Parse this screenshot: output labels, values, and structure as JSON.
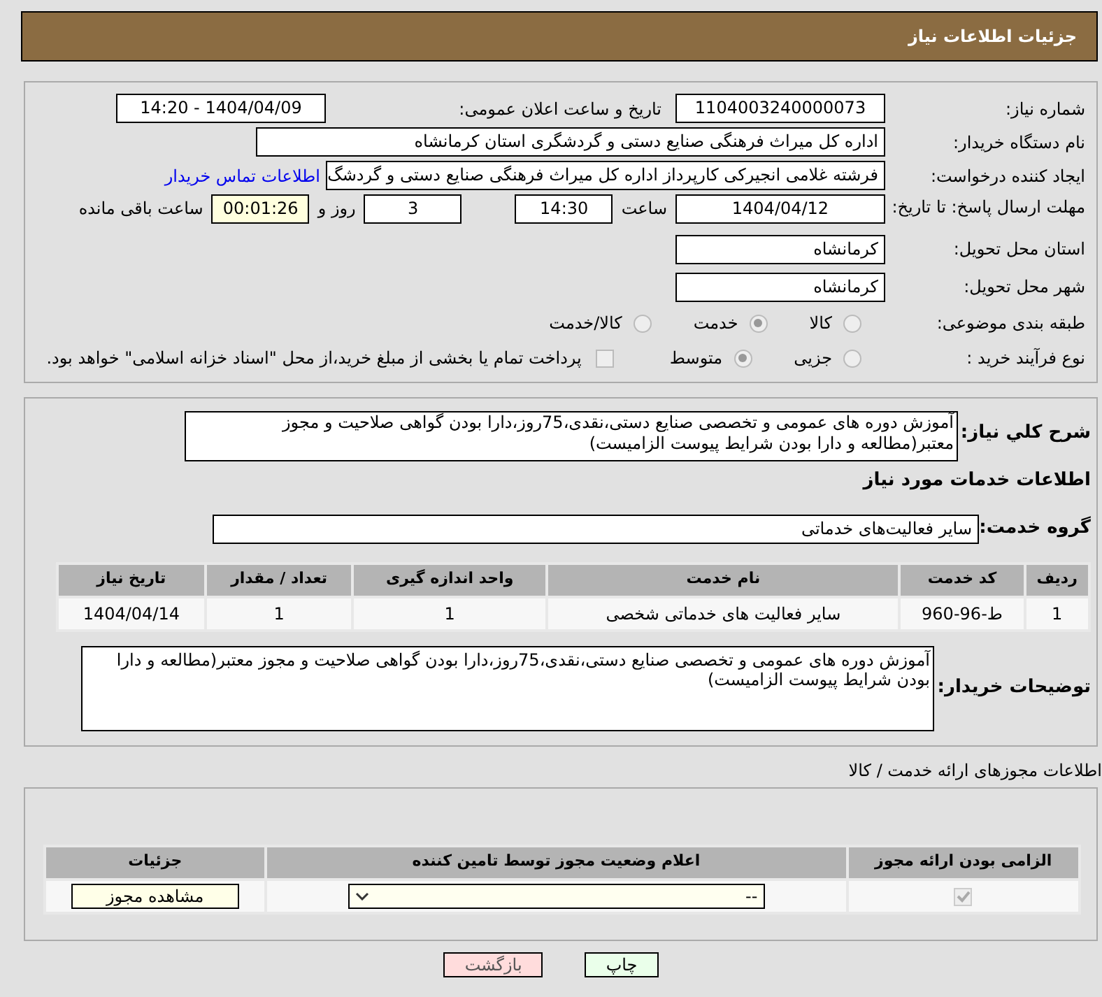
{
  "header": {
    "title": "جزئیات اطلاعات نیاز"
  },
  "details": {
    "need_number": {
      "label": "شماره نیاز:",
      "value": "1104003240000073"
    },
    "announce": {
      "label": "تاریخ و ساعت اعلان عمومی:",
      "value": "1404/04/09 - 14:20"
    },
    "buyer_org": {
      "label": "نام دستگاه خریدار:",
      "value": "اداره کل میراث فرهنگی  صنایع دستی و گردشگری استان کرمانشاه"
    },
    "creator": {
      "label": "ایجاد کننده درخواست:",
      "value": "فرشته غلامی انجیرکی کارپرداز اداره کل میراث فرهنگی  صنایع دستی و گردشگ",
      "link": "اطلاعات تماس خریدار"
    },
    "deadline": {
      "label": "مهلت ارسال پاسخ: تا تاریخ:",
      "date": "1404/04/12",
      "time_label": "ساعت",
      "time": "14:30",
      "days": "3",
      "days_label": "روز و",
      "remaining": "00:01:26",
      "remaining_label": "ساعت باقی مانده"
    },
    "province": {
      "label": "استان محل تحویل:",
      "value": "کرمانشاه"
    },
    "city": {
      "label": "شهر محل تحویل:",
      "value": "کرمانشاه"
    },
    "category": {
      "label": "طبقه بندی موضوعی:",
      "options": [
        {
          "label": "کالا",
          "selected": false
        },
        {
          "label": "خدمت",
          "selected": true
        },
        {
          "label": "کالا/خدمت",
          "selected": false
        }
      ]
    },
    "process": {
      "label": "نوع فرآیند خرید :",
      "options": [
        {
          "label": "جزیی",
          "selected": false
        },
        {
          "label": "متوسط",
          "selected": true
        }
      ],
      "payment": {
        "checked": false,
        "text": "پرداخت تمام یا بخشی از مبلغ خرید،از محل \"اسناد خزانه اسلامی\" خواهد بود."
      }
    }
  },
  "need": {
    "description_label": "شرح کلي نياز:",
    "description": "آموزش دوره های عمومی و تخصصی صنایع دستی،نقدی،75روز،دارا بودن گواهی صلاحیت و مجوز معتبر(مطالعه و دارا بودن شرایط پیوست الزامیست)",
    "services_heading": "اطلاعات خدمات مورد نیاز",
    "service_group": {
      "label": "گروه خدمت:",
      "value": "سایر فعالیت‌های خدماتی"
    },
    "table": {
      "columns": [
        "ردیف",
        "کد خدمت",
        "نام خدمت",
        "واحد اندازه گیری",
        "تعداد / مقدار",
        "تاریخ نیاز"
      ],
      "rows": [
        [
          "1",
          "ط-96-960",
          "سایر فعالیت های خدماتی شخصی",
          "1",
          "1",
          "1404/04/14"
        ]
      ]
    },
    "notes_label": "توضیحات خریدار:",
    "notes": "آموزش دوره های عمومی و تخصصی صنایع دستی،نقدی،75روز،دارا بودن گواهی صلاحیت و مجوز معتبر(مطالعه و دارا بودن شرایط پیوست الزامیست)"
  },
  "licenses": {
    "title": "اطلاعات مجوزهای ارائه خدمت / کالا",
    "columns": [
      "الزامی بودن ارائه مجوز",
      "اعلام وضعیت مجوز توسط تامین کننده",
      "جزئیات"
    ],
    "rows": [
      {
        "required": true,
        "status": "--",
        "button": "مشاهده مجوز"
      }
    ]
  },
  "buttons": [
    {
      "kind": "print",
      "label": "چاپ"
    },
    {
      "kind": "back",
      "label": "بازگشت"
    }
  ]
}
